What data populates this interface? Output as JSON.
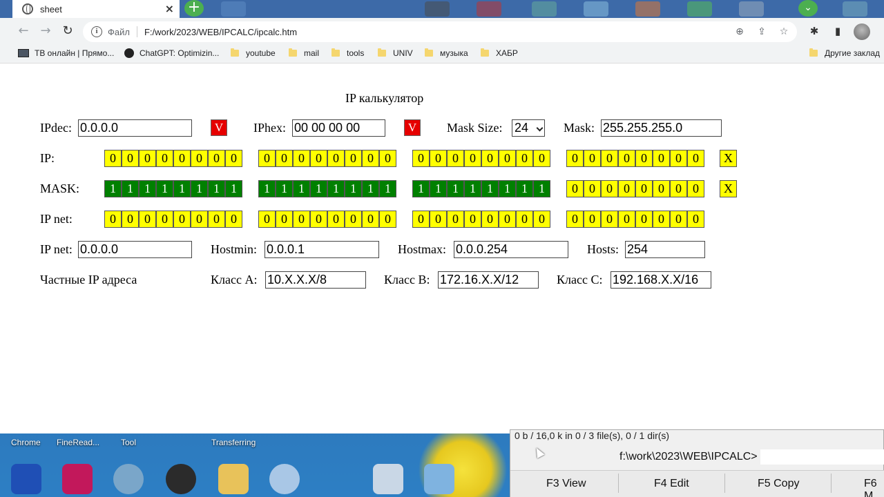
{
  "browser": {
    "tab_title": "sheet",
    "omnibox": {
      "file_label": "Файл",
      "url": "F:/work/2023/WEB/IPCALC/ipcalc.htm"
    },
    "bookmarks": [
      {
        "label": "ТВ онлайн | Прямо...",
        "icon": "tv-icon"
      },
      {
        "label": "ChatGPT: Optimizin...",
        "icon": "chatgpt-icon"
      },
      {
        "label": "youtube",
        "icon": "folder-icon"
      },
      {
        "label": "mail",
        "icon": "folder-icon"
      },
      {
        "label": "tools",
        "icon": "folder-icon"
      },
      {
        "label": "UNIV",
        "icon": "folder-icon"
      },
      {
        "label": "музыка",
        "icon": "folder-icon"
      },
      {
        "label": "ХАБР",
        "icon": "folder-icon"
      }
    ],
    "other_bookmarks": "Другие заклад"
  },
  "calc": {
    "title": "IP калькулятор",
    "ipdec_label": "IPdec:",
    "ipdec_value": "0.0.0.0",
    "v_label": "V",
    "iphex_label": "IPhex:",
    "iphex_value": "00 00 00 00",
    "mask_size_label": "Mask Size:",
    "mask_size_value": "24",
    "mask_label": "Mask:",
    "mask_value": "255.255.255.0",
    "ip_row_label": "IP:",
    "mask_row_label": "MASK:",
    "ipnet_row_label": "IP net:",
    "x_label": "X",
    "ip_bits": [
      [
        "0",
        "0",
        "0",
        "0",
        "0",
        "0",
        "0",
        "0"
      ],
      [
        "0",
        "0",
        "0",
        "0",
        "0",
        "0",
        "0",
        "0"
      ],
      [
        "0",
        "0",
        "0",
        "0",
        "0",
        "0",
        "0",
        "0"
      ],
      [
        "0",
        "0",
        "0",
        "0",
        "0",
        "0",
        "0",
        "0"
      ]
    ],
    "mask_bits": [
      [
        "1",
        "1",
        "1",
        "1",
        "1",
        "1",
        "1",
        "1"
      ],
      [
        "1",
        "1",
        "1",
        "1",
        "1",
        "1",
        "1",
        "1"
      ],
      [
        "1",
        "1",
        "1",
        "1",
        "1",
        "1",
        "1",
        "1"
      ],
      [
        "0",
        "0",
        "0",
        "0",
        "0",
        "0",
        "0",
        "0"
      ]
    ],
    "ipnet_bits": [
      [
        "0",
        "0",
        "0",
        "0",
        "0",
        "0",
        "0",
        "0"
      ],
      [
        "0",
        "0",
        "0",
        "0",
        "0",
        "0",
        "0",
        "0"
      ],
      [
        "0",
        "0",
        "0",
        "0",
        "0",
        "0",
        "0",
        "0"
      ],
      [
        "0",
        "0",
        "0",
        "0",
        "0",
        "0",
        "0",
        "0"
      ]
    ],
    "ipnet_label": "IP net:",
    "ipnet_value": "0.0.0.0",
    "hostmin_label": "Hostmin:",
    "hostmin_value": "0.0.0.1",
    "hostmax_label": "Hostmax:",
    "hostmax_value": "0.0.0.254",
    "hosts_label": "Hosts:",
    "hosts_value": "254",
    "private_label": "Частные IP адреса",
    "class_a_label": "Класс A:",
    "class_a_value": "10.X.X.X/8",
    "class_b_label": "Класс B:",
    "class_b_value": "172.16.X.X/12",
    "class_c_label": "Класс C:",
    "class_c_value": "192.168.X.X/16"
  },
  "colors": {
    "bit_zero": "#ffff00",
    "bit_one": "#008000",
    "v_button": "#e60000"
  },
  "desktop": {
    "labels": [
      "Chrome",
      "FineRead...",
      "Tool",
      "Transferring"
    ]
  },
  "far_manager": {
    "status": "0 b / 16,0 k in 0 / 3 file(s), 0 / 1 dir(s)",
    "prompt": "f:\\work\\2023\\WEB\\IPCALC>",
    "keys": [
      "F3 View",
      "F4 Edit",
      "F5 Copy",
      "F6 M"
    ]
  }
}
